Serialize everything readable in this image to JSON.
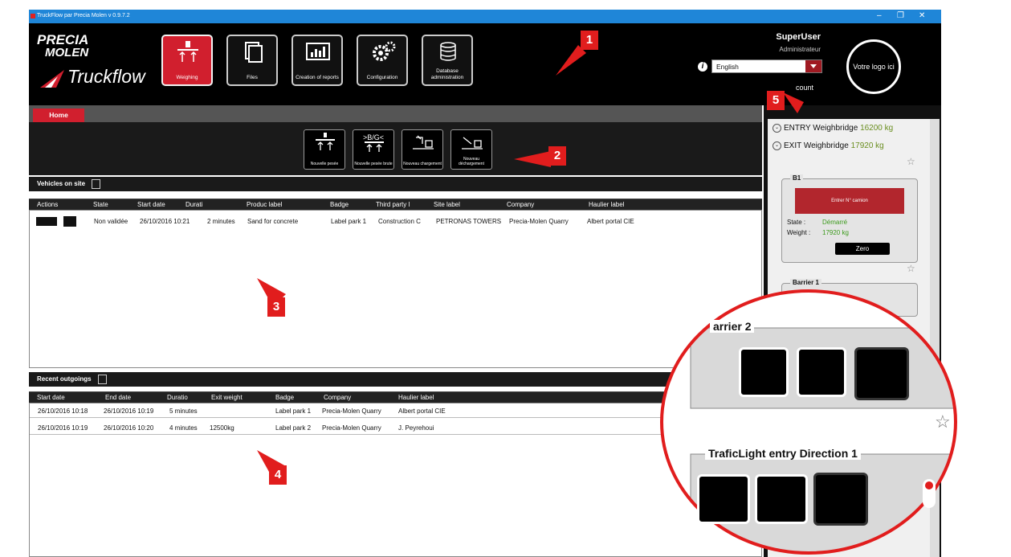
{
  "window": {
    "title": "TruckFlow par Precia Molen v 0.9.7.2"
  },
  "brand": {
    "line1": "PRECIA",
    "line2": "MOLEN",
    "product": "Truckflow"
  },
  "nav": [
    {
      "label": "Weighing",
      "icon": "weighing-icon"
    },
    {
      "label": "Files",
      "icon": "files-icon"
    },
    {
      "label": "Creation of reports",
      "icon": "reports-icon"
    },
    {
      "label": "Configuration",
      "icon": "gear-icon"
    },
    {
      "label": "Database administration",
      "icon": "database-icon"
    }
  ],
  "user": {
    "name": "SuperUser",
    "role": "Administrateur",
    "account": "count"
  },
  "language": {
    "selected": "English"
  },
  "logo_placeholder": "Votre logo ici",
  "tabs": {
    "home": "Home"
  },
  "quick_actions": [
    {
      "label": "Nouvelle pesée"
    },
    {
      "label": "Nouvelle pesée brute",
      "glyph": ">B/G<"
    },
    {
      "label": "Nouveau chargement"
    },
    {
      "label": "Nouveau déchargement"
    }
  ],
  "vehicles": {
    "title": "Vehicles on site",
    "columns": [
      "Actions",
      "State",
      "Start date",
      "Durati",
      "Produc label",
      "Badge",
      "Third party l",
      "Site label",
      "Company",
      "Haulier label"
    ],
    "rows": [
      {
        "state": "Non validée",
        "start": "26/10/2016 10:21",
        "duration": "2 minutes",
        "product": "Sand for concrete",
        "badge": "Label park 1",
        "third": "Construction C",
        "site": "PETRONAS TOWERS",
        "company": "Precia-Molen Quarry",
        "haulier": "Albert portal CIE"
      }
    ]
  },
  "outgoings": {
    "title": "Recent outgoings",
    "columns": [
      "Start date",
      "End date",
      "Duratio",
      "Exit weight",
      "Badge",
      "Company",
      "Haulier label"
    ],
    "rows": [
      {
        "start": "26/10/2016 10:18",
        "end": "26/10/2016 10:19",
        "duration": "5 minutes",
        "weight": "",
        "badge": "Label park 1",
        "company": "Precia-Molen Quarry",
        "haulier": "Albert portal CIE"
      },
      {
        "start": "26/10/2016 10:19",
        "end": "26/10/2016 10:20",
        "duration": "4 minutes",
        "weight": "12500kg",
        "badge": "Label park 2",
        "company": "Precia-Molen Quarry",
        "haulier": "J. Peyrehoui"
      }
    ]
  },
  "weighbridges": [
    {
      "name": "ENTRY Weighbridge",
      "weight": "16200 kg"
    },
    {
      "name": "EXIT Weighbridge",
      "weight": "17920 kg"
    }
  ],
  "b1": {
    "title": "B1",
    "display": "Entrer N° camion",
    "state_label": "State :",
    "state_value": "Démarré",
    "weight_label": "Weight :",
    "weight_value": "17920 kg",
    "zero": "Zero"
  },
  "barrier1": {
    "title": "Barrier 1"
  },
  "zoom": {
    "barrier2": "arrier 2",
    "trafic": "TraficLight entry Direction 1"
  },
  "callouts": [
    "1",
    "2",
    "3",
    "4",
    "5"
  ],
  "colors": {
    "accent": "#d11f2e",
    "titlebar": "#1f86d8",
    "kg": "#6a8e20",
    "callout": "#e11d1d"
  }
}
